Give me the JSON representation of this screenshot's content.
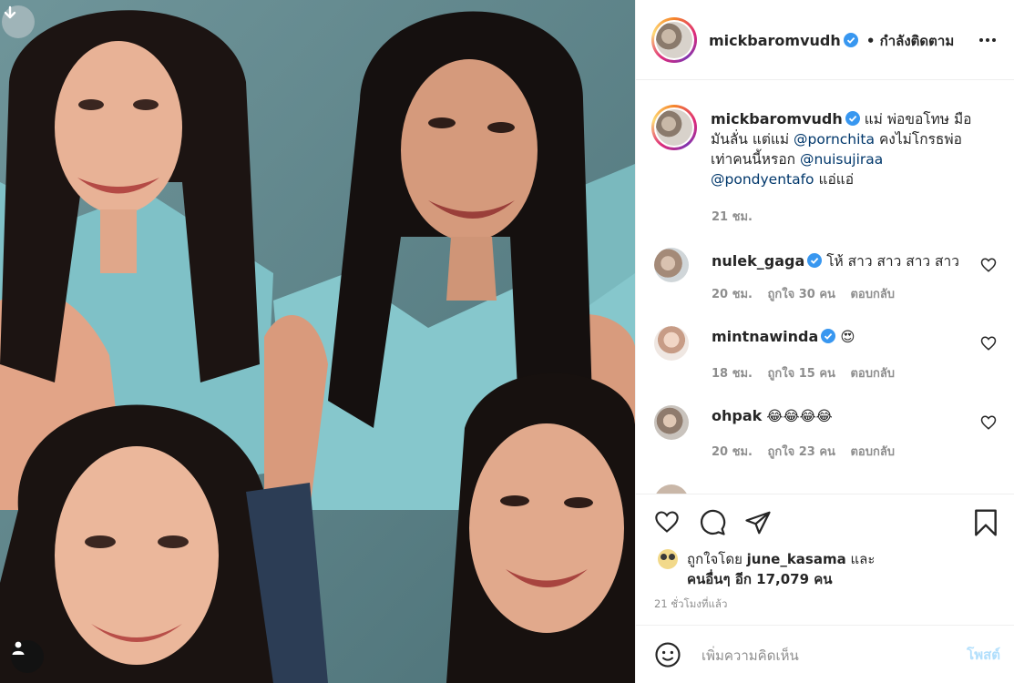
{
  "post": {
    "author": "mickbaromvudh",
    "follow_status": "• กำลังติดตาม",
    "caption_parts": {
      "text1": "แม่ พ่อขอโทษ มือมันลั่น แต่แม่ ",
      "mention1": "@pornchita",
      "text2": " คงไม่โกรธพ่อเท่าคนนี้หรอก ",
      "mention2": "@nuisujiraa",
      "mention3": "@pondyentafo",
      "text3": " แอ่แอ่"
    },
    "caption_time": "21 ชม."
  },
  "comments": [
    {
      "user": "nulek_gaga",
      "verified": true,
      "text": "โห้ สาว สาว สาว สาว",
      "time": "20 ชม.",
      "likes": "ถูกใจ 30 คน",
      "reply": "ตอบกลับ"
    },
    {
      "user": "mintnawinda",
      "verified": true,
      "text": "😍",
      "time": "18 ชม.",
      "likes": "ถูกใจ 15 คน",
      "reply": "ตอบกลับ"
    },
    {
      "user": "ohpak",
      "verified": false,
      "text": "😂😂😂😂",
      "time": "20 ชม.",
      "likes": "ถูกใจ 23 คน",
      "reply": "ตอบกลับ"
    }
  ],
  "likes_summary": {
    "prefix": "ถูกใจโดย ",
    "user": "june_kasama",
    "and": " และ",
    "others": "คนอื่นๆ อีก 17,079 คน"
  },
  "post_time": "21 ชั่วโมงที่แล้ว",
  "add_comment": {
    "placeholder": "เพิ่มความคิดเห็น",
    "post_label": "โพสต์"
  },
  "icons": {
    "download": "download-icon",
    "user": "user-icon",
    "more": "more-options-icon",
    "like": "heart-icon",
    "comment": "comment-icon",
    "share": "share-icon",
    "save": "bookmark-icon",
    "emoji": "emoji-icon",
    "verified": "verified-badge-icon"
  },
  "colors": {
    "verified": "#3897f0",
    "link": "#00376b",
    "post_button_disabled": "#b2dffc",
    "muted_text": "#8e8e8e"
  }
}
